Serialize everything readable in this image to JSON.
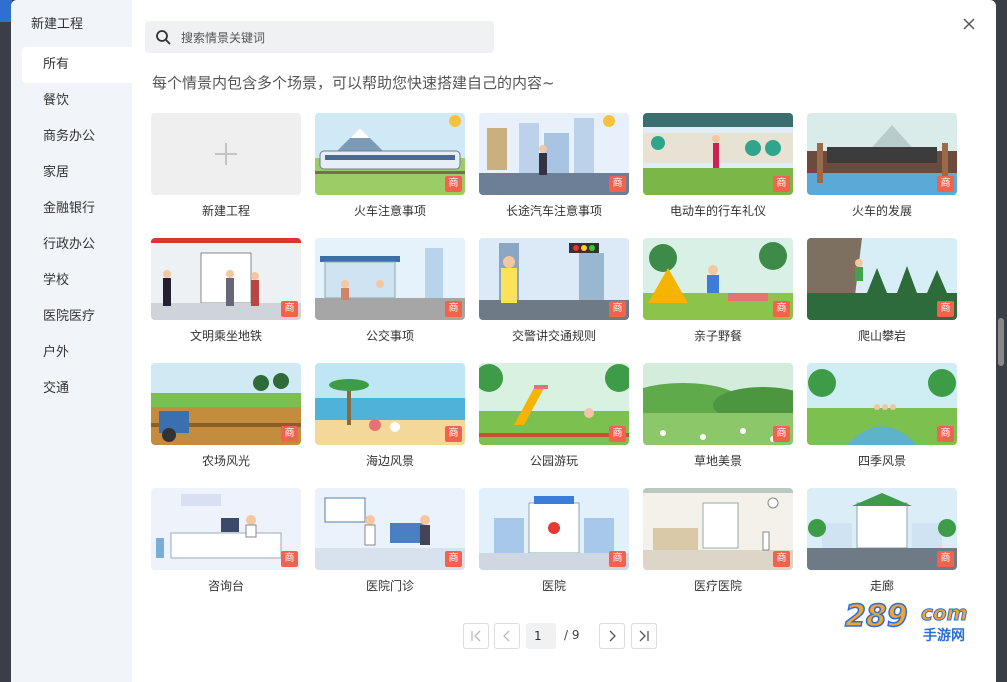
{
  "sidebar": {
    "title": "新建工程",
    "items": [
      {
        "label": "所有",
        "active": true
      },
      {
        "label": "餐饮"
      },
      {
        "label": "商务办公"
      },
      {
        "label": "家居"
      },
      {
        "label": "金融银行"
      },
      {
        "label": "行政办公"
      },
      {
        "label": "学校"
      },
      {
        "label": "医院医疗"
      },
      {
        "label": "户外"
      },
      {
        "label": "交通"
      }
    ]
  },
  "search": {
    "placeholder": "搜索情景关键词"
  },
  "subtitle": "每个情景内包含多个场景，可以帮助您快速搭建自己的内容~",
  "badge_text": "商",
  "new_project_label": "新建工程",
  "scenes": [
    {
      "label": "火车注意事项",
      "theme": "train"
    },
    {
      "label": "长途汽车注意事项",
      "theme": "bus-station"
    },
    {
      "label": "电动车的行车礼仪",
      "theme": "e-bike"
    },
    {
      "label": "火车的发展",
      "theme": "steam-train"
    },
    {
      "label": "文明乘坐地铁",
      "theme": "subway"
    },
    {
      "label": "公交事项",
      "theme": "bus-stop"
    },
    {
      "label": "交警讲交通规则",
      "theme": "traffic-police"
    },
    {
      "label": "亲子野餐",
      "theme": "picnic"
    },
    {
      "label": "爬山攀岩",
      "theme": "climbing"
    },
    {
      "label": "农场风光",
      "theme": "farm"
    },
    {
      "label": "海边风景",
      "theme": "beach"
    },
    {
      "label": "公园游玩",
      "theme": "park"
    },
    {
      "label": "草地美景",
      "theme": "meadow"
    },
    {
      "label": "四季风景",
      "theme": "seasons"
    },
    {
      "label": "咨询台",
      "theme": "info-desk"
    },
    {
      "label": "医院门诊",
      "theme": "clinic"
    },
    {
      "label": "医院",
      "theme": "hospital"
    },
    {
      "label": "医疗医院",
      "theme": "ward"
    },
    {
      "label": "走廊",
      "theme": "corridor"
    }
  ],
  "pagination": {
    "current": "1",
    "total": "/ 9"
  },
  "watermark": {
    "number": "289",
    "suffix": "com",
    "brand": "手游网"
  },
  "colors": {
    "badge": "#f2624d",
    "sidebar_bg": "#f1f4f9",
    "search_bg": "#f0f1f3"
  }
}
